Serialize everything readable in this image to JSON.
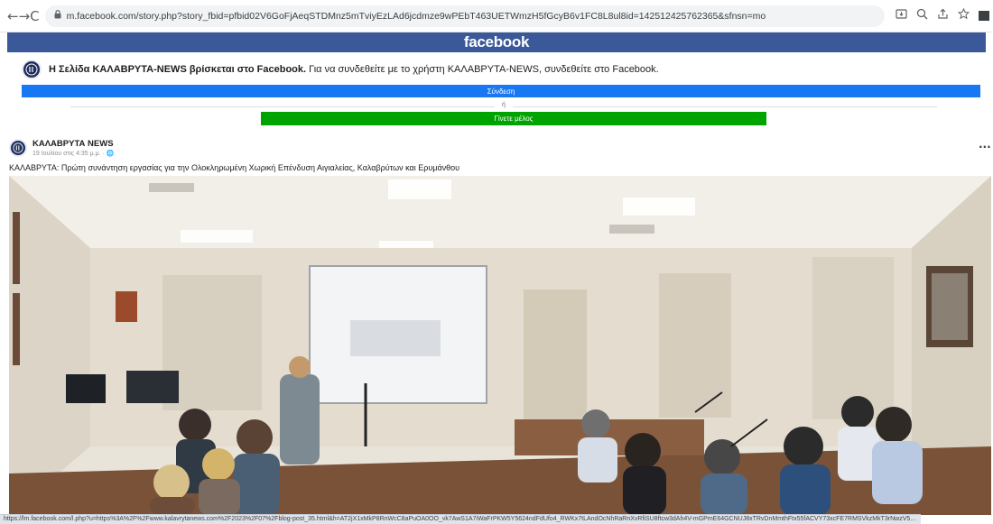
{
  "browser": {
    "url": "m.facebook.com/story.php?story_fbid=pfbid02V6GoFjAeqSTDMnz5mTviyEzLAd6jcdmze9wPEbT463UETWmzH5fGcyB6v1FC8L8ul8id=142512425762365&sfnsn=mo",
    "back_icon": "←",
    "forward_icon": "→",
    "reload_icon": "C",
    "lock_icon": "🔒",
    "profile_initial": "S"
  },
  "header": {
    "logo": "facebook"
  },
  "banner": {
    "page_name": "Η Σελίδα ΚΑΛΑΒΡΥΤΑ-NEWS βρίσκεται στο Facebook.",
    "prompt": " Για να συνδεθείτε με το χρήστη ΚΑΛΑΒΡΥΤΑ-NEWS, συνδεθείτε στο Facebook.",
    "login_label": "Σύνδεση",
    "or_label": "ή",
    "signup_label": "Γίνετε μέλος"
  },
  "post": {
    "author": "ΚΑΛΑΒΡΥΤΑ NEWS",
    "time": "19 Ιουλίου στις 4:35 μ.μ. · 🌐",
    "more_icon": "···",
    "text": "ΚΑΛΑΒΡΥΤΑ: Πρώτη συνάντηση εργασίας για την Ολοκληρωμένη Χωρική Επένδυση Αιγιαλείας, Καλαβρύτων και Ερυμάνθου"
  },
  "status_bar": {
    "link": "https://lm.facebook.com/l.php?u=https%3A%2F%2Fwww.kalavrytanews.com%2F2023%2F07%2Fblog-post_35.html&h=AT2jX1xMkP8RnWcC8aPuOA0OO_vk7AwS1A7iWaFrPKW5Y5624ndFdUfo4_RWKx7tLAndOcNhRaRnXvRfiSU8ftcw3dAh4V-mGPmE64GCNUJ8xTRvDnMmthFtx55fACVY73xcFE7RMSVkzMkT3rNwzV5THLSOvk"
  },
  "colors": {
    "fb_blue": "#3b5998",
    "login_blue": "#1877f2",
    "signup_green": "#00a400"
  }
}
